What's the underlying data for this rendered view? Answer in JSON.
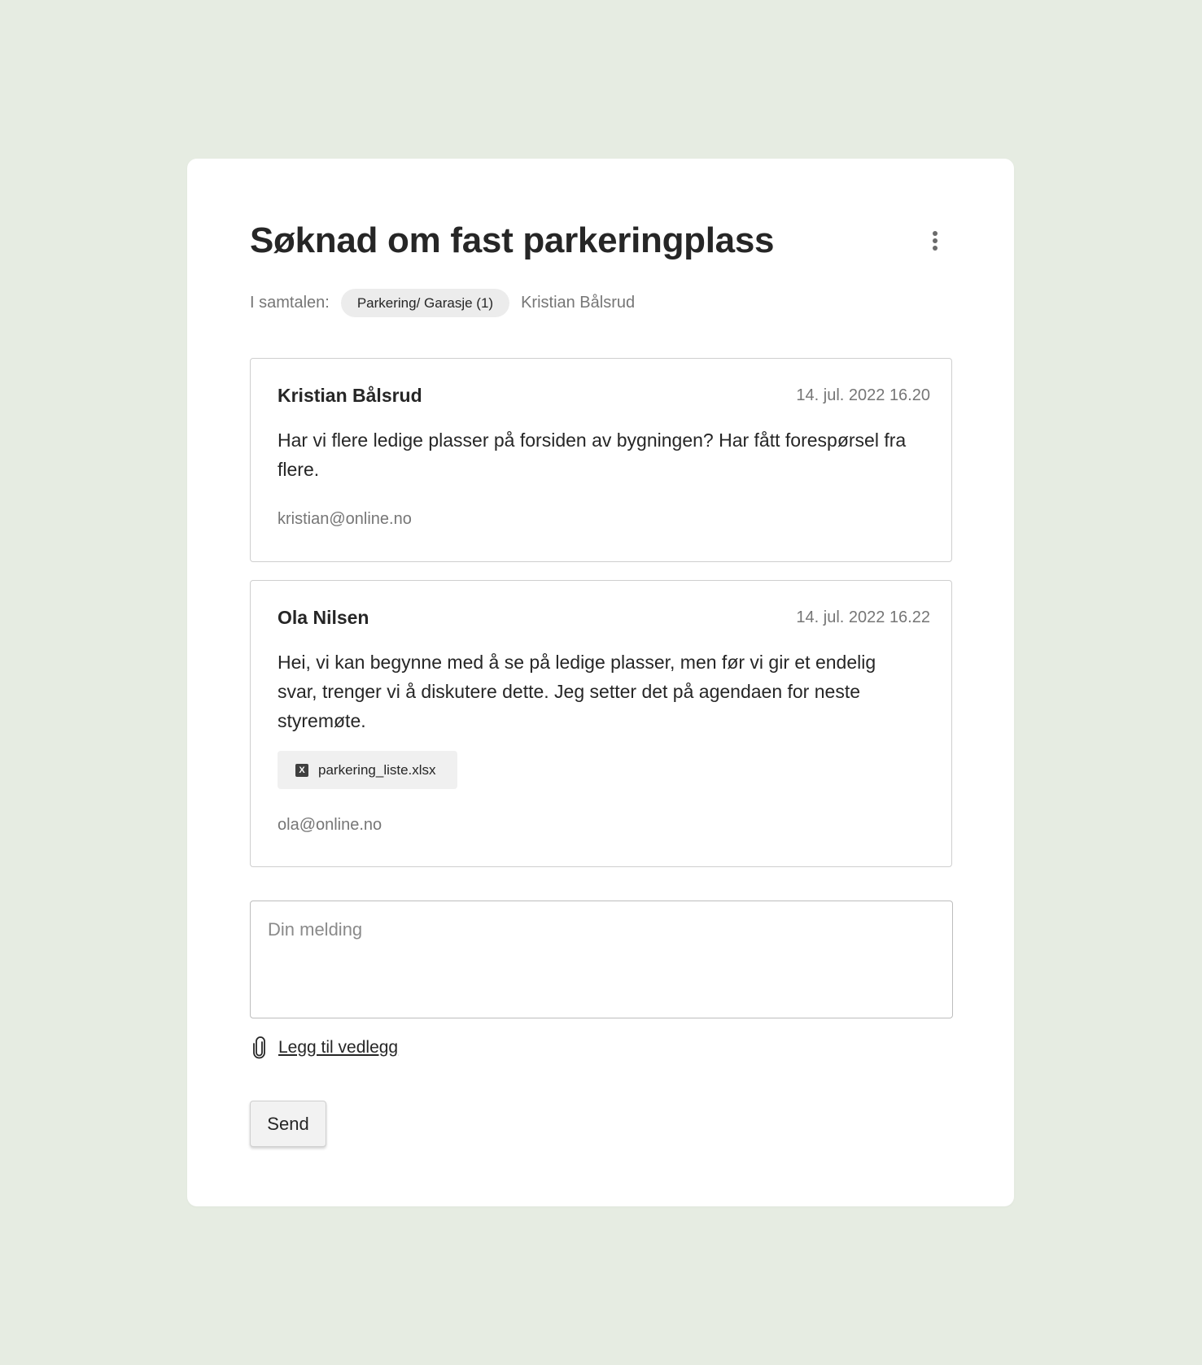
{
  "conversation": {
    "title": "Søknad om fast parkeringplass",
    "participants_label": "I samtalen:",
    "group_chip": "Parkering/ Garasje (1)",
    "participant_name": "Kristian Bålsrud"
  },
  "messages": [
    {
      "author": "Kristian Bålsrud",
      "timestamp": "14. jul. 2022 16.20",
      "body": "Har vi flere ledige plasser på forsiden av bygningen? Har fått forespørsel fra flere.",
      "email": "kristian@online.no"
    },
    {
      "author": "Ola Nilsen",
      "timestamp": "14. jul. 2022 16.22",
      "body": "Hei, vi kan begynne med å se på ledige plasser, men før vi gir et endelig svar, trenger vi å diskutere dette. Jeg setter det på agendaen for neste styremøte.",
      "attachment": {
        "filename": "parkering_liste.xlsx",
        "icon": "excel-file-icon",
        "icon_glyph": "X"
      },
      "email": "ola@online.no"
    }
  ],
  "composer": {
    "placeholder": "Din melding",
    "attach_label": "Legg til vedlegg",
    "send_label": "Send"
  },
  "colors": {
    "background": "#e6ece2",
    "card": "#ffffff",
    "chip": "#ececec",
    "muted_text": "#767676"
  }
}
